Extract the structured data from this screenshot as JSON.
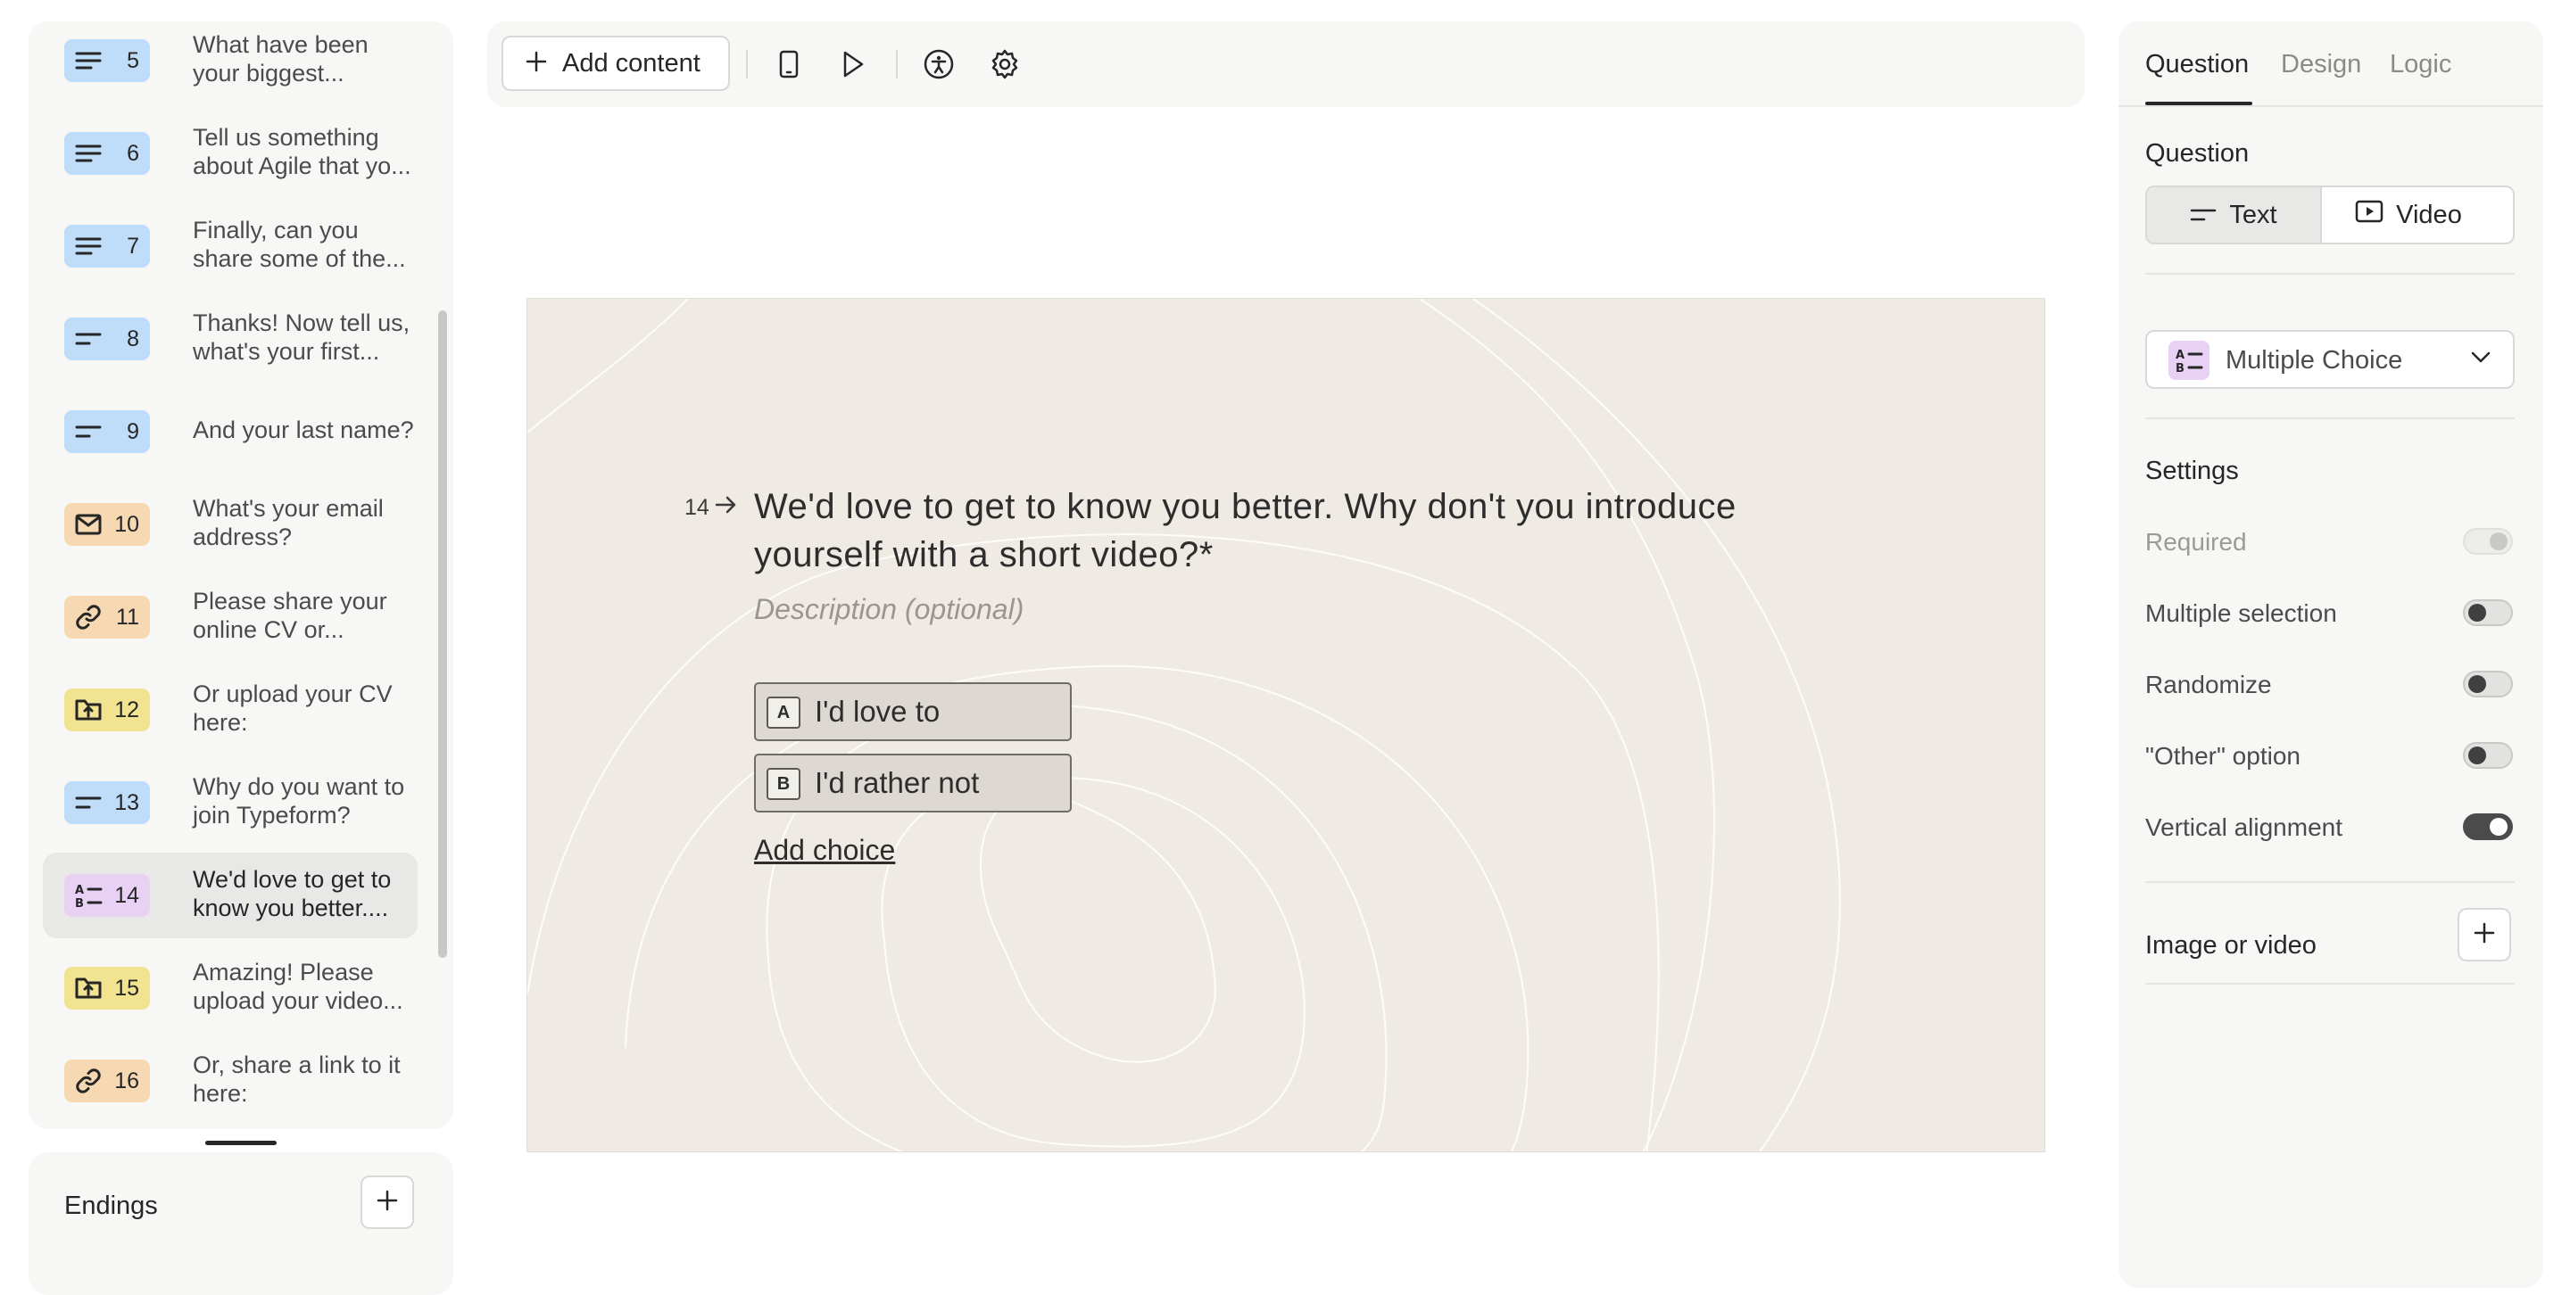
{
  "sidebar": {
    "items": [
      {
        "number": "5",
        "text": "What have been your biggest...",
        "icon": "text-lines-icon",
        "color": "#bfdcf8"
      },
      {
        "number": "6",
        "text": "Tell us something about Agile that yo...",
        "icon": "text-lines-icon",
        "color": "#bfdcf8"
      },
      {
        "number": "7",
        "text": "Finally, can you share some of the...",
        "icon": "text-lines-icon",
        "color": "#bfdcf8"
      },
      {
        "number": "8",
        "text": "Thanks! Now tell us, what's your first...",
        "icon": "short-text-icon",
        "color": "#bfdcf8"
      },
      {
        "number": "9",
        "text": "And your last name?",
        "icon": "short-text-icon",
        "color": "#bfdcf8"
      },
      {
        "number": "10",
        "text": "What's your email address?",
        "icon": "mail-icon",
        "color": "#f6d8b2"
      },
      {
        "number": "11",
        "text": "Please share your online CV or...",
        "icon": "link-icon",
        "color": "#f6d8b2"
      },
      {
        "number": "12",
        "text": "Or upload your CV here:",
        "icon": "file-upload-icon",
        "color": "#f2e391"
      },
      {
        "number": "13",
        "text": "Why do you want to join Typeform?",
        "icon": "short-text-icon",
        "color": "#bfdcf8"
      },
      {
        "number": "14",
        "text": "We'd love to get to know you better....",
        "icon": "multiple-choice-icon",
        "color": "#e8d1f4"
      },
      {
        "number": "15",
        "text": "Amazing! Please upload your video...",
        "icon": "file-upload-icon",
        "color": "#f2e391"
      },
      {
        "number": "16",
        "text": "Or, share a link to it here:",
        "icon": "link-icon",
        "color": "#f6d8b2"
      }
    ],
    "endings_label": "Endings"
  },
  "toolbar": {
    "add_content_label": "Add content"
  },
  "question": {
    "number": "14",
    "title": "We'd love to get to know you better. Why don't you introduce yourself with a short video?*",
    "description_placeholder": "Description (optional)",
    "choices": [
      {
        "key": "A",
        "label": "I'd love to"
      },
      {
        "key": "B",
        "label": "I'd rather not"
      }
    ],
    "add_choice_label": "Add choice"
  },
  "panel": {
    "tabs": [
      "Question",
      "Design",
      "Logic"
    ],
    "question_heading": "Question",
    "format_options": [
      "Text",
      "Video"
    ],
    "type_label": "Multiple Choice",
    "settings_heading": "Settings",
    "settings": [
      {
        "label": "Required",
        "state": "disabled"
      },
      {
        "label": "Multiple selection",
        "state": "off"
      },
      {
        "label": "Randomize",
        "state": "off"
      },
      {
        "label": "\"Other\" option",
        "state": "off"
      },
      {
        "label": "Vertical alignment",
        "state": "on"
      }
    ],
    "image_video_label": "Image or video"
  }
}
